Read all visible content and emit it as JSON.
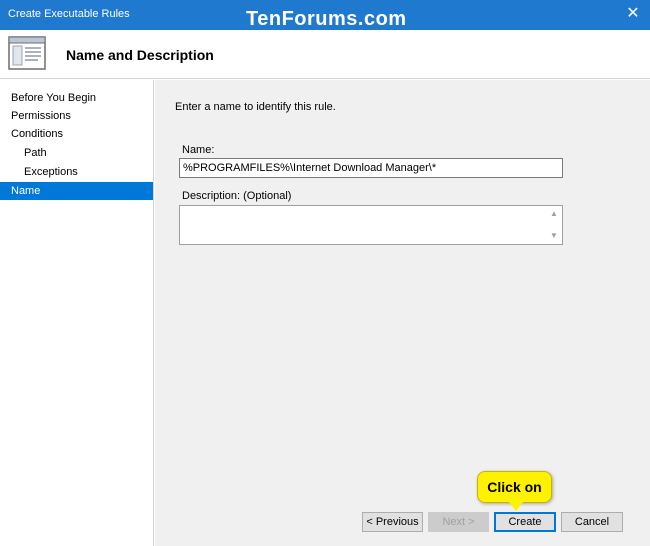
{
  "window": {
    "title": "Create Executable Rules",
    "watermark": "TenForums.com",
    "close_glyph": "✕"
  },
  "header": {
    "icon": "wizard-page-icon",
    "title": "Name and Description"
  },
  "sidebar": {
    "steps": [
      {
        "label": "Before You Begin"
      },
      {
        "label": "Permissions"
      },
      {
        "label": "Conditions"
      },
      {
        "label": "Path"
      },
      {
        "label": "Exceptions"
      },
      {
        "label": "Name",
        "active": true
      }
    ]
  },
  "main": {
    "intro": "Enter a name to identify this rule.",
    "name_label": "Name:",
    "name_value": "%PROGRAMFILES%\\Internet Download Manager\\*",
    "description_label": "Description: (Optional)",
    "description_value": ""
  },
  "callout": {
    "text": "Click on"
  },
  "buttons": {
    "previous": "< Previous",
    "next": "Next >",
    "create": "Create",
    "cancel": "Cancel"
  }
}
